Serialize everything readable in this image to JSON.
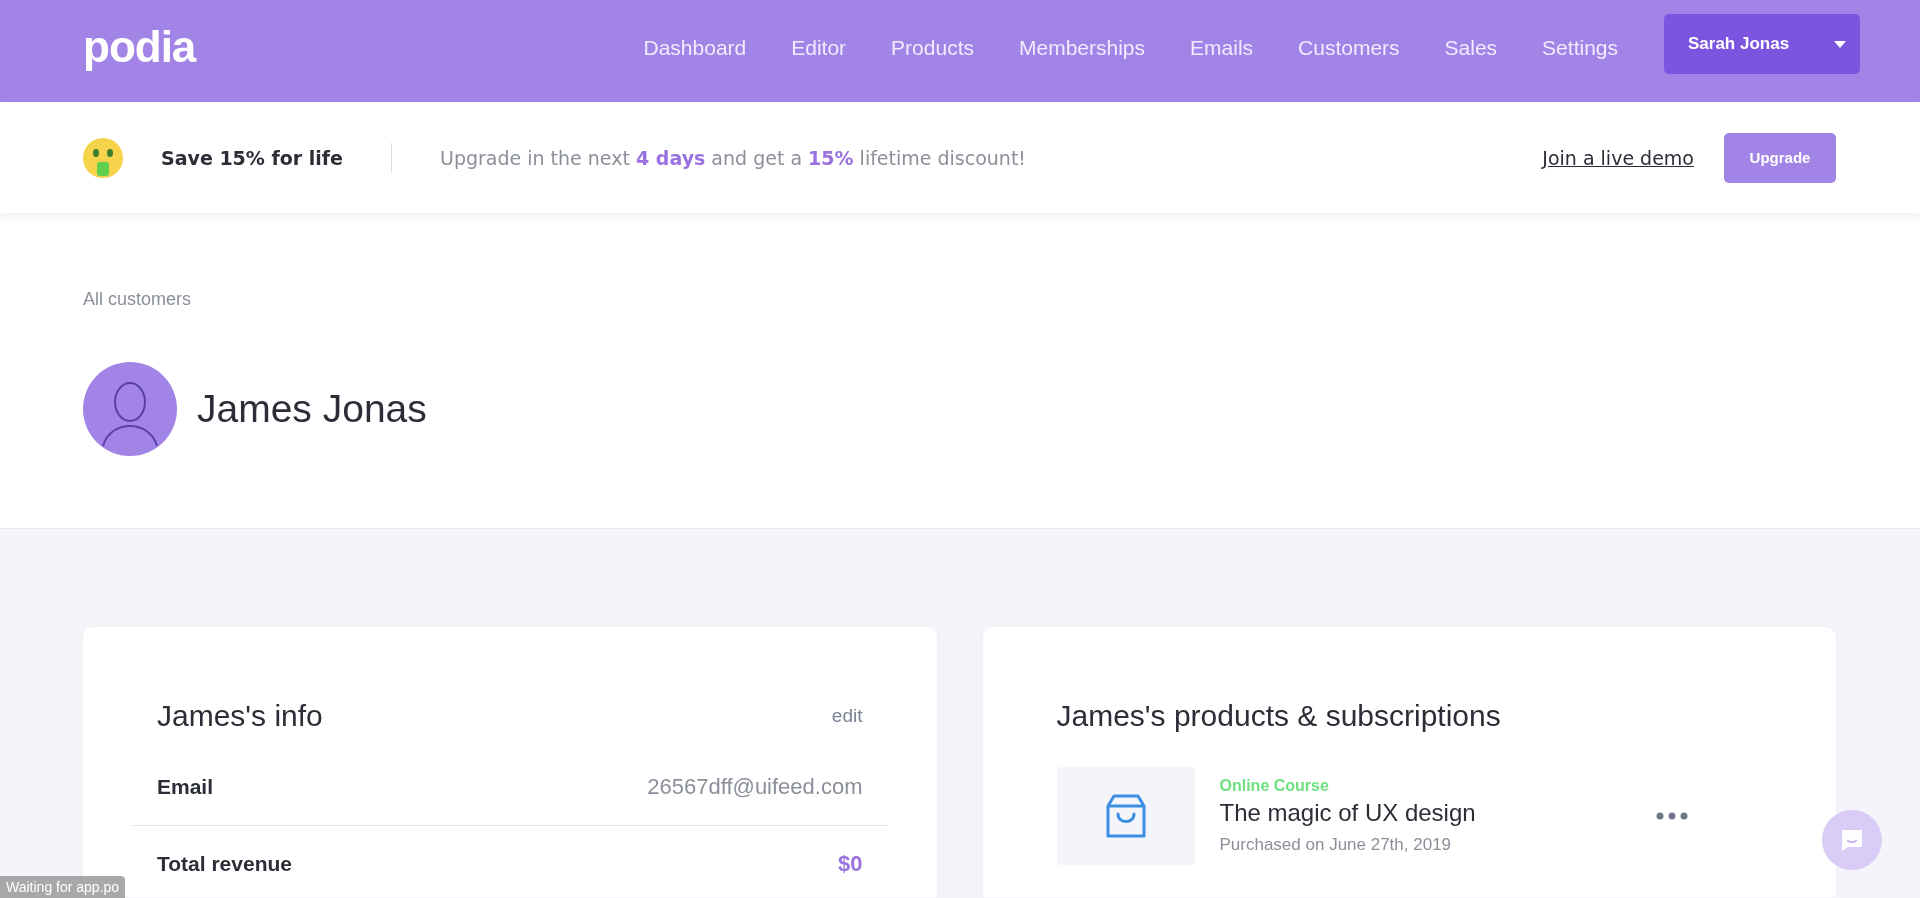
{
  "header": {
    "logo": "podia",
    "nav": [
      {
        "label": "Dashboard",
        "selected": false
      },
      {
        "label": "Editor",
        "selected": false
      },
      {
        "label": "Products",
        "selected": false
      },
      {
        "label": "Memberships",
        "selected": false
      },
      {
        "label": "Emails",
        "selected": false
      },
      {
        "label": "Customers",
        "selected": false
      },
      {
        "label": "Sales",
        "selected": false
      },
      {
        "label": "Settings",
        "selected": false
      }
    ],
    "account": "Sarah Jonas"
  },
  "banner": {
    "title": "Save 15% for life",
    "message": "Upgrade in the next **4 days** and get a **15%** lifetime discount!",
    "link": "Join a live demo",
    "button": "Upgrade"
  },
  "breadcrumb": "All customers",
  "customer": {
    "name": "James Jonas"
  },
  "info_card": {
    "title": "James's info",
    "action": "edit",
    "rows": [
      {
        "label": "Email",
        "value": "26567dff@uifeed.com",
        "kind": "text"
      },
      {
        "label": "Total revenue",
        "value": "$0",
        "kind": "money"
      }
    ]
  },
  "products_card": {
    "title": "James's products & subscriptions",
    "items": [
      {
        "type": "Online Course",
        "name": "The magic of UX design",
        "date": "Purchased on June 27th, 2019"
      }
    ]
  },
  "status_bubble": "Waiting for app.po"
}
